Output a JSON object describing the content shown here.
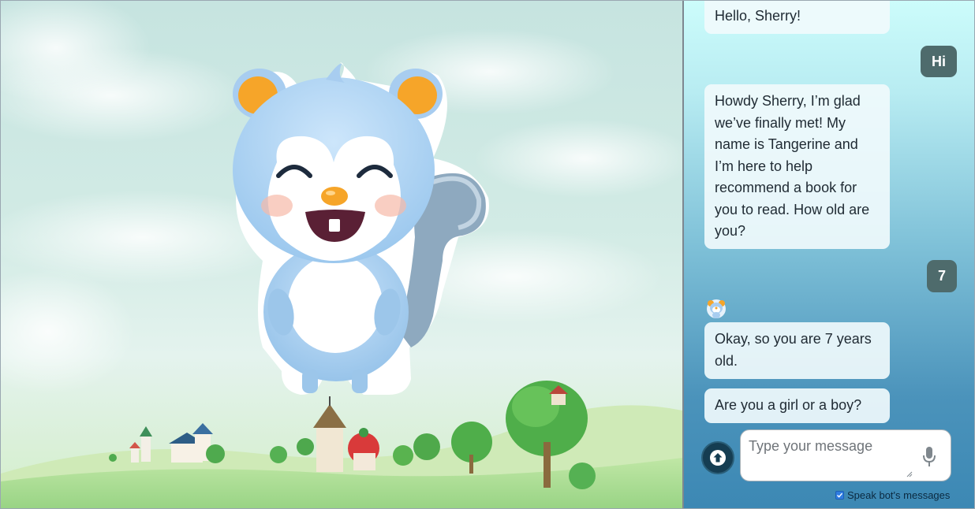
{
  "chat": {
    "messages": [
      {
        "sender": "bot",
        "text": "Hello, Sherry!"
      },
      {
        "sender": "user",
        "text": "Hi"
      },
      {
        "sender": "bot",
        "text": "Howdy Sherry, I’m glad we’ve finally met! My name is Tangerine and I’m here to help recommend a book for you to read. How old are you?"
      },
      {
        "sender": "user",
        "text": "7"
      },
      {
        "sender": "bot",
        "text": "Okay, so you are 7 years old."
      },
      {
        "sender": "bot",
        "text": "Are you a girl or a boy?"
      }
    ],
    "input_placeholder": "Type your message",
    "speak_label": "Speak bot's messages",
    "speak_checked": true
  },
  "icons": {
    "send": "arrow-up-icon",
    "mic": "microphone-icon",
    "avatar": "squirrel-avatar-icon",
    "mascot": "squirrel-mascot"
  },
  "colors": {
    "user_bubble": "#4e6b6c",
    "bot_bubble": "#f0fafc",
    "send_button": "#153d52",
    "checkbox": "#2f7de1"
  }
}
